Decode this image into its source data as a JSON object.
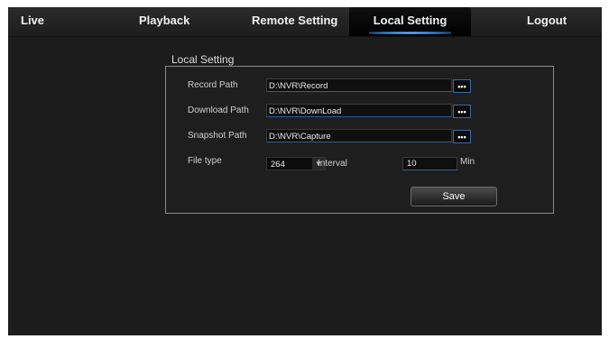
{
  "nav": {
    "live": "Live",
    "playback": "Playback",
    "remote_setting": "Remote Setting",
    "local_setting": "Local Setting",
    "logout": "Logout"
  },
  "section_title": "Local Setting",
  "form": {
    "record_path_label": "Record Path",
    "record_path_value": "D:\\NVR\\Record",
    "download_path_label": "Download Path",
    "download_path_value": "D:\\NVR\\DownLoad",
    "snapshot_path_label": "Snapshot Path",
    "snapshot_path_value": "D:\\NVR\\Capture",
    "browse_label": "•••",
    "file_type_label": "File type",
    "file_type_value": "264",
    "interval_label": "Interval",
    "interval_value": "10",
    "interval_unit": "Min",
    "save_label": "Save"
  },
  "colors": {
    "accent": "#3a6aa8",
    "active_tab_glow": "#78bfff",
    "background": "#1c1c1c"
  }
}
